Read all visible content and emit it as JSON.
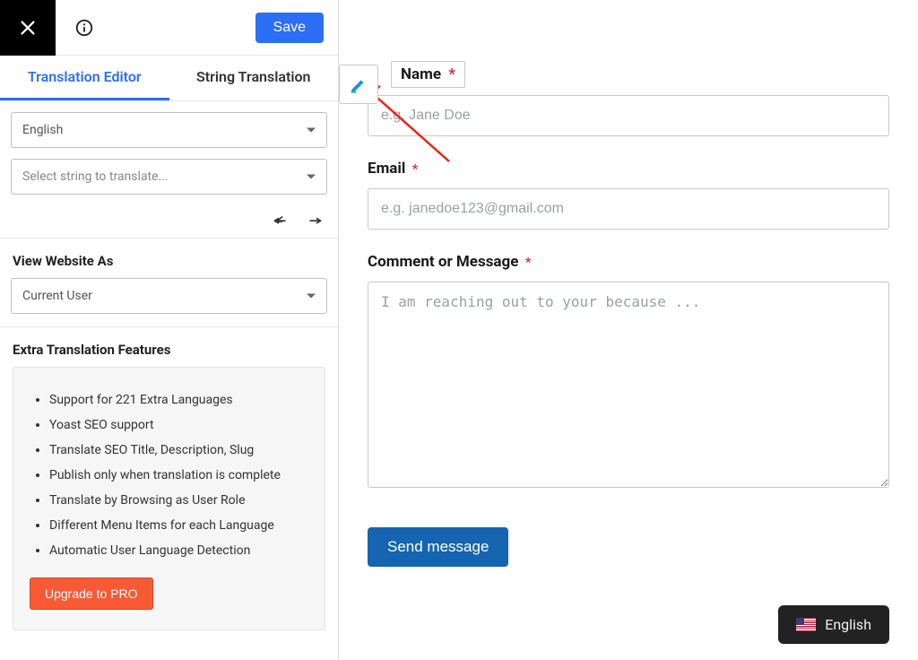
{
  "topbar": {
    "save_label": "Save"
  },
  "tabs": {
    "editor": "Translation Editor",
    "string": "String Translation"
  },
  "lang_select": {
    "value": "English"
  },
  "string_select": {
    "placeholder": "Select string to translate..."
  },
  "view_as": {
    "title": "View Website As",
    "value": "Current User"
  },
  "extras": {
    "title": "Extra Translation Features",
    "items": [
      "Support for 221 Extra Languages",
      "Yoast SEO support",
      "Translate SEO Title, Description, Slug",
      "Publish only when translation is complete",
      "Translate by Browsing as User Role",
      "Different Menu Items for each Language",
      "Automatic User Language Detection"
    ],
    "upgrade_label": "Upgrade to PRO"
  },
  "form": {
    "name": {
      "label": "Name",
      "placeholder": "e.g. Jane Doe"
    },
    "email": {
      "label": "Email",
      "placeholder": "e.g. janedoe123@gmail.com"
    },
    "message": {
      "label": "Comment or Message",
      "placeholder": "I am reaching out to your because ..."
    },
    "submit_label": "Send message"
  },
  "lang_switch": {
    "label": "English"
  },
  "asterisk": "*"
}
